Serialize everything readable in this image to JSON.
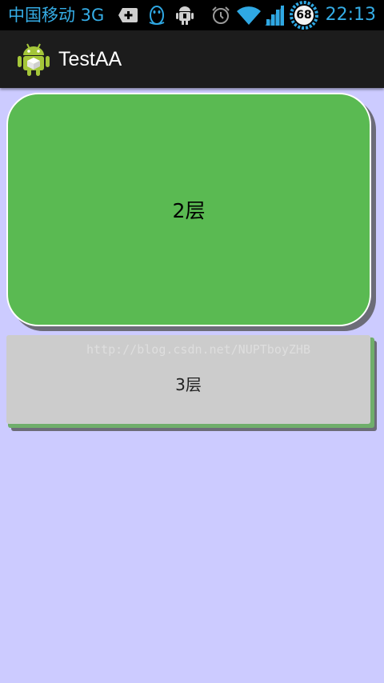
{
  "status_bar": {
    "carrier": "中国移动 3G",
    "battery_level": "68",
    "time": "22:13",
    "icons": [
      "add-icon",
      "qq-icon",
      "usb-debug-icon",
      "alarm-icon",
      "wifi-icon",
      "signal-icon",
      "battery-icon"
    ]
  },
  "action_bar": {
    "title": "TestAA",
    "icon": "android-icon"
  },
  "layers": {
    "layer2_label": "2层",
    "layer3_label": "3层",
    "watermark": "http://blog.csdn.net/NUPTboyZHB"
  },
  "colors": {
    "background": "#cccbff",
    "layer2": "#5aba52",
    "layer3": "#cccccc",
    "status_text": "#35ade6"
  }
}
